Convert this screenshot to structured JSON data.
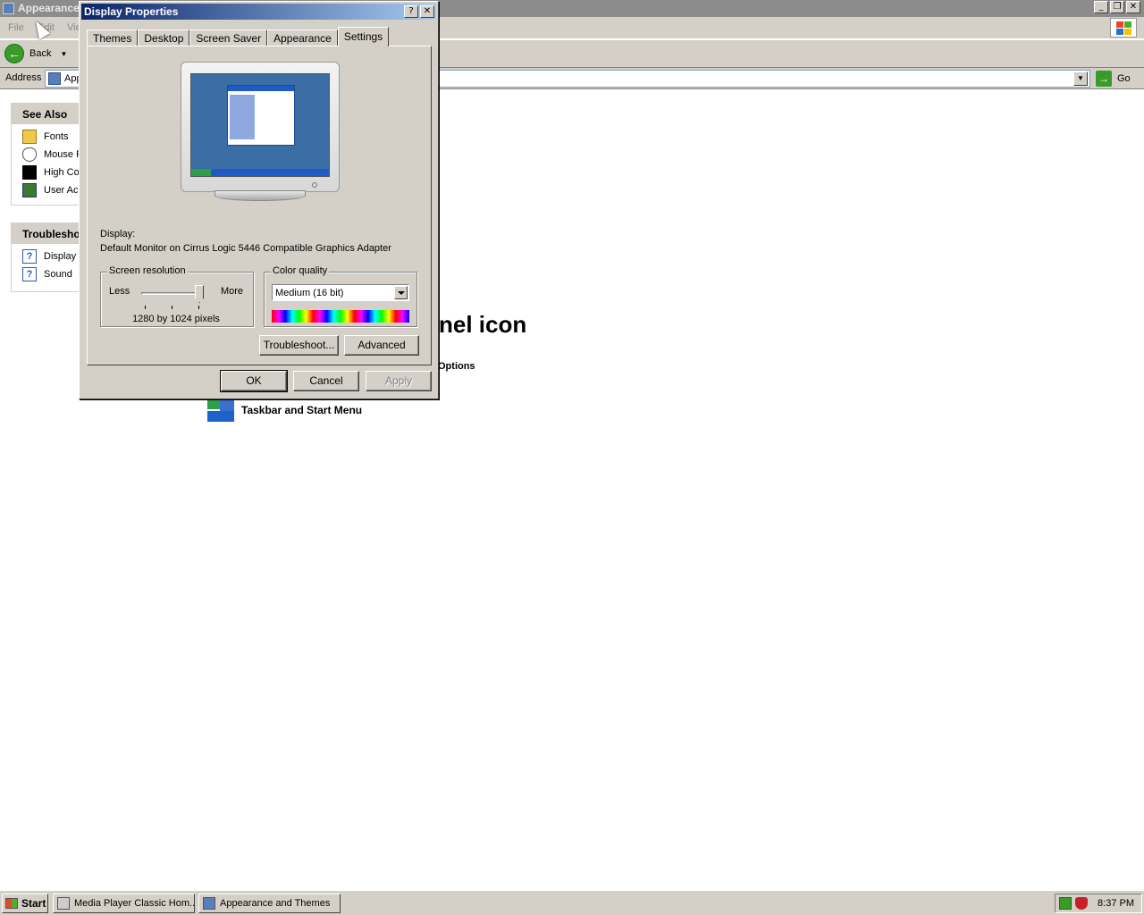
{
  "background_window": {
    "title": "Appearance",
    "menu": {
      "file": "File",
      "edit": "Edit",
      "view": "Vie"
    },
    "toolbar": {
      "back": "Back"
    },
    "address": {
      "label": "Address",
      "value": "App",
      "go": "Go"
    },
    "see_also": {
      "title": "See Also",
      "items": [
        {
          "label": "Fonts",
          "icon": "fonts-folder-icon"
        },
        {
          "label": "Mouse P",
          "icon": "mouse-icon"
        },
        {
          "label": "High Cor",
          "icon": "high-contrast-icon"
        },
        {
          "label": "User Acc",
          "icon": "user-accounts-icon"
        }
      ]
    },
    "troubleshooters": {
      "title": "Troublesho",
      "items": [
        {
          "label": "Display",
          "icon": "help-icon"
        },
        {
          "label": "Sound",
          "icon": "help-icon"
        }
      ]
    },
    "heading_fragment": "nel icon",
    "options_fragment": "Options",
    "taskbar_link": "Taskbar and Start Menu"
  },
  "dialog": {
    "title": "Display Properties",
    "tabs": [
      "Themes",
      "Desktop",
      "Screen Saver",
      "Appearance",
      "Settings"
    ],
    "active_tab": "Settings",
    "display_label": "Display:",
    "display_value": "Default Monitor on Cirrus Logic 5446 Compatible Graphics Adapter",
    "screen_resolution": {
      "title": "Screen resolution",
      "less": "Less",
      "more": "More",
      "value": "1280 by 1024 pixels",
      "slider_level": 1.0
    },
    "color_quality": {
      "title": "Color quality",
      "selected": "Medium (16 bit)"
    },
    "buttons": {
      "troubleshoot": "Troubleshoot...",
      "advanced": "Advanced",
      "ok": "OK",
      "cancel": "Cancel",
      "apply": "Apply"
    }
  },
  "taskbar": {
    "start": "Start",
    "tasks": [
      "Media Player Classic Hom...",
      "Appearance and Themes"
    ],
    "clock": "8:37 PM"
  },
  "colors": {
    "dialog_title_start": "#0a246a",
    "dialog_title_end": "#a6caf0",
    "face": "#d4d0c8",
    "inactive_title": "#8c8c8c"
  }
}
